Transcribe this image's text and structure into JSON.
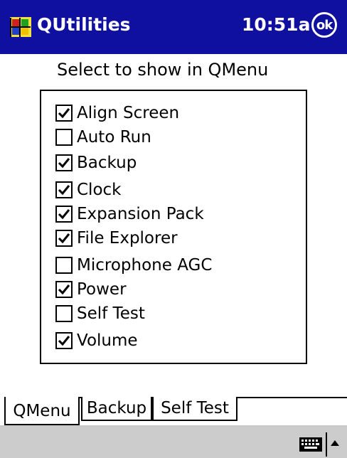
{
  "titlebar": {
    "start_icon": "windows-flag-start-icon",
    "title": "QUtilities",
    "time": "10:51a",
    "ok_label": "ok",
    "bg_color": "#1010a0"
  },
  "instruction": "Select to show in QMenu",
  "items": [
    {
      "label": "Align Screen",
      "checked": true
    },
    {
      "label": "Auto Run",
      "checked": false
    },
    {
      "label": "Backup",
      "checked": true
    },
    {
      "label": "Clock",
      "checked": true
    },
    {
      "label": "Expansion Pack",
      "checked": true
    },
    {
      "label": "File Explorer",
      "checked": true
    },
    {
      "label": "Microphone AGC",
      "checked": false
    },
    {
      "label": "Power",
      "checked": true
    },
    {
      "label": "Self Test",
      "checked": false
    },
    {
      "label": "Volume",
      "checked": true
    }
  ],
  "tabs": [
    {
      "label": "QMenu",
      "active": true
    },
    {
      "label": "Backup",
      "active": false
    },
    {
      "label": "Self Test",
      "active": false
    }
  ],
  "bottombar": {
    "keyboard_icon": "keyboard-icon",
    "sip_arrow_icon": "up-arrow-icon",
    "bg_color": "#cccccc"
  }
}
